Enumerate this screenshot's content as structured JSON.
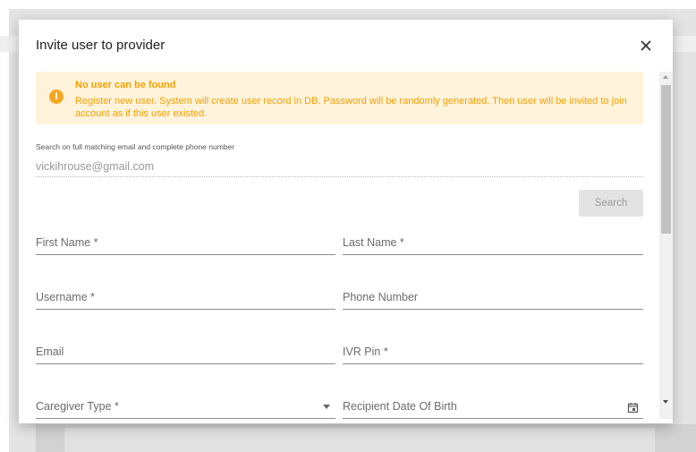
{
  "dialog": {
    "title": "Invite user to provider",
    "close_icon": "close-icon"
  },
  "alert": {
    "icon": "info-icon",
    "icon_glyph": "i",
    "title": "No user can be found",
    "message": "Register new user. System will create user record in DB. Password will be randomly generated. Then user will be invited to join account as if this user existed.",
    "color": "#f5a000",
    "background": "#fff3dc"
  },
  "search": {
    "label": "Search on full matching email and complete phone number",
    "value": "vickihrouse@gmail.com",
    "button_label": "Search"
  },
  "form": {
    "first_name_label": "First Name *",
    "last_name_label": "Last Name *",
    "username_label": "Username *",
    "phone_label": "Phone Number",
    "email_label": "Email",
    "ivr_pin_label": "IVR Pin *",
    "caregiver_type_label": "Caregiver Type *",
    "recipient_dob_label": "Recipient Date Of Birth"
  }
}
